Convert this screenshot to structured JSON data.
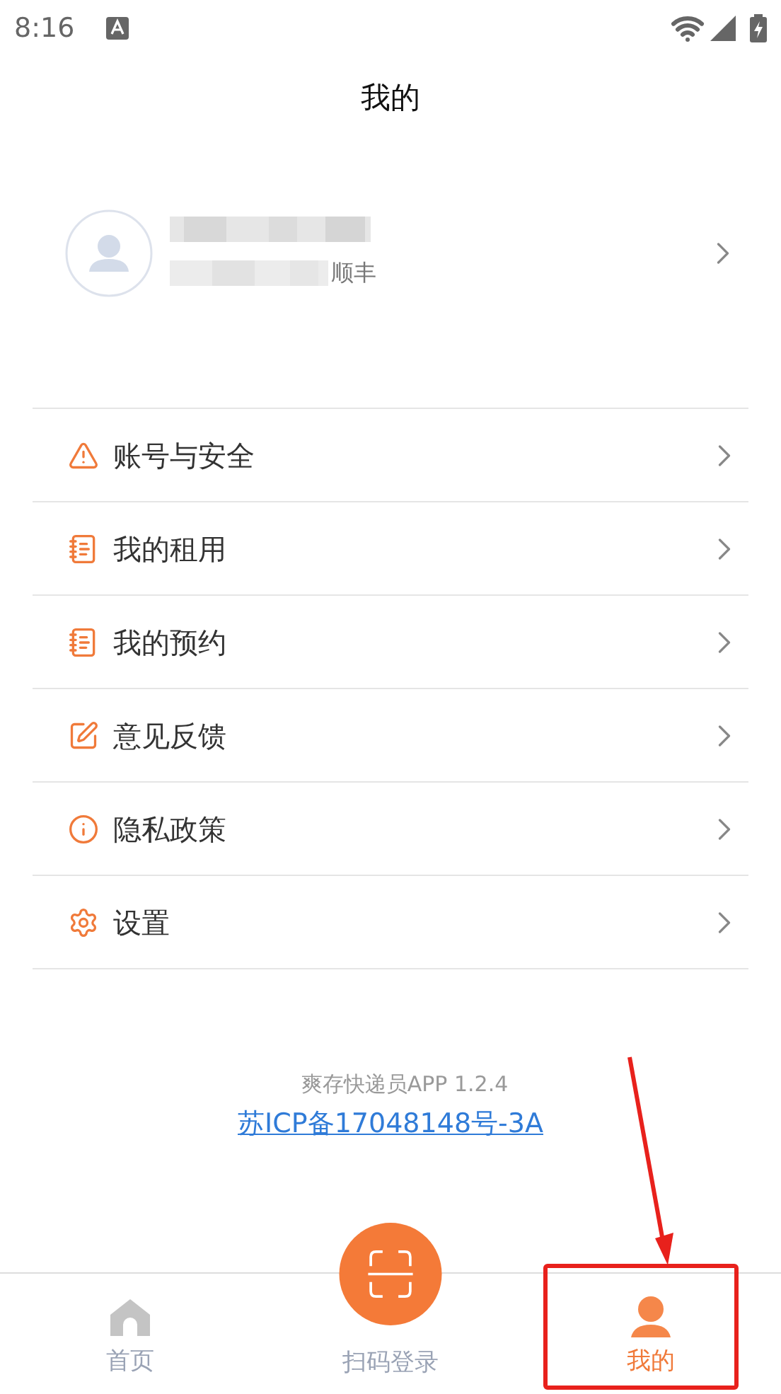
{
  "status_bar": {
    "time": "8:16"
  },
  "header": {
    "title": "我的"
  },
  "profile": {
    "company": "顺丰"
  },
  "menu": [
    {
      "kind": "warning",
      "label": "账号与安全"
    },
    {
      "kind": "list",
      "label": "我的租用"
    },
    {
      "kind": "list",
      "label": "我的预约"
    },
    {
      "kind": "edit",
      "label": "意见反馈"
    },
    {
      "kind": "info",
      "label": "隐私政策"
    },
    {
      "kind": "settings",
      "label": "设置"
    }
  ],
  "footer": {
    "version": "爽存快递员APP 1.2.4",
    "icp_link": "苏ICP备17048148号-3A"
  },
  "bottom_nav": [
    {
      "kind": "home",
      "label": "首页",
      "selected": false
    },
    {
      "kind": "scan",
      "label": "扫码登录",
      "selected": false
    },
    {
      "kind": "profile",
      "label": "我的",
      "selected": true
    }
  ]
}
